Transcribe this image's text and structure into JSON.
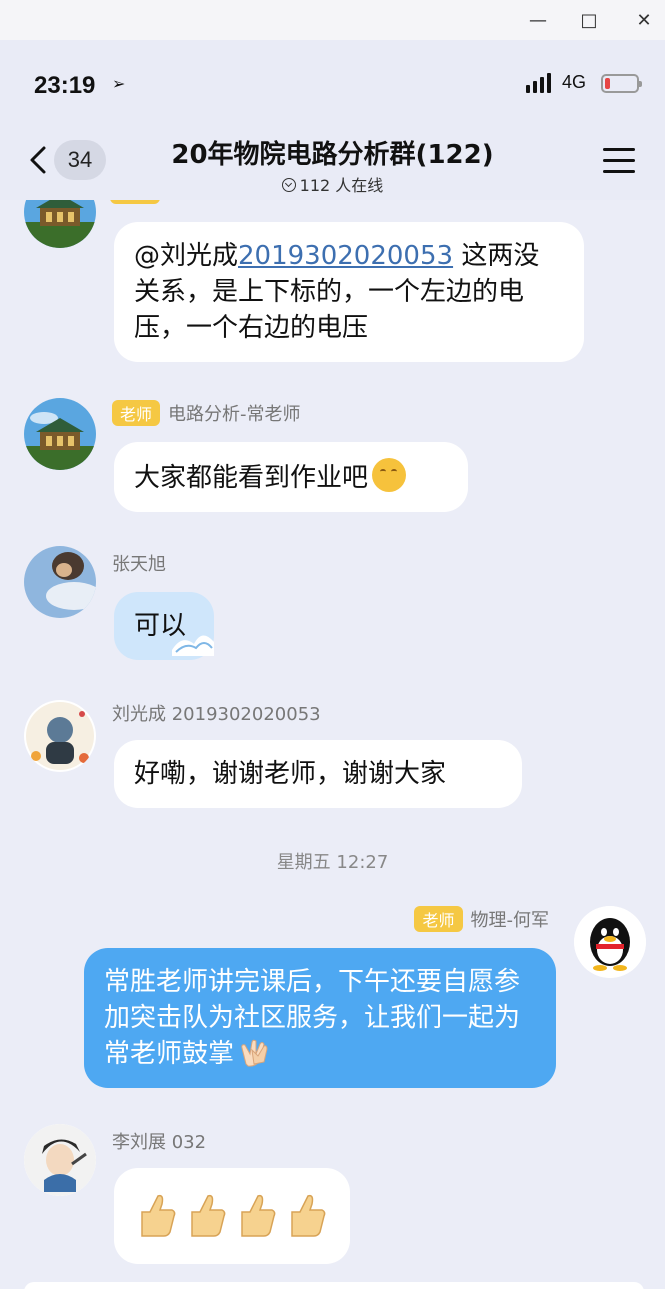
{
  "status_bar": {
    "time": "23:19",
    "network": "4G"
  },
  "header": {
    "back_count": "34",
    "title": "20年物院电路分析群(122)",
    "online": "112 人在线"
  },
  "messages": [
    {
      "mention": "@刘光成",
      "mention_id": "2019302020053",
      "text": " 这两没关系，是上下标的，一个左边的电压，一个右边的电压"
    },
    {
      "tag": "老师",
      "sender": "电路分析-常老师",
      "text": "大家都能看到作业吧"
    },
    {
      "sender": "张天旭",
      "text": "可以"
    },
    {
      "sender": "刘光成 2019302020053",
      "text": "好嘞，谢谢老师，谢谢大家"
    },
    {
      "timestamp": "星期五 12:27"
    },
    {
      "tag": "老师",
      "sender": "物理-何军",
      "text": "常胜老师讲完课后，下午还要自愿参加突击队为社区服务，让我们一起为常老师鼓掌"
    },
    {
      "sender": "李刘展 032"
    }
  ],
  "colors": {
    "background": "#ebedf7",
    "tag": "#f5c843",
    "self_bubble": "#4ea8f2"
  },
  "icons": [
    "back-icon",
    "menu-icon",
    "online-icon",
    "location-arrow-icon",
    "signal-icon",
    "battery-icon"
  ]
}
